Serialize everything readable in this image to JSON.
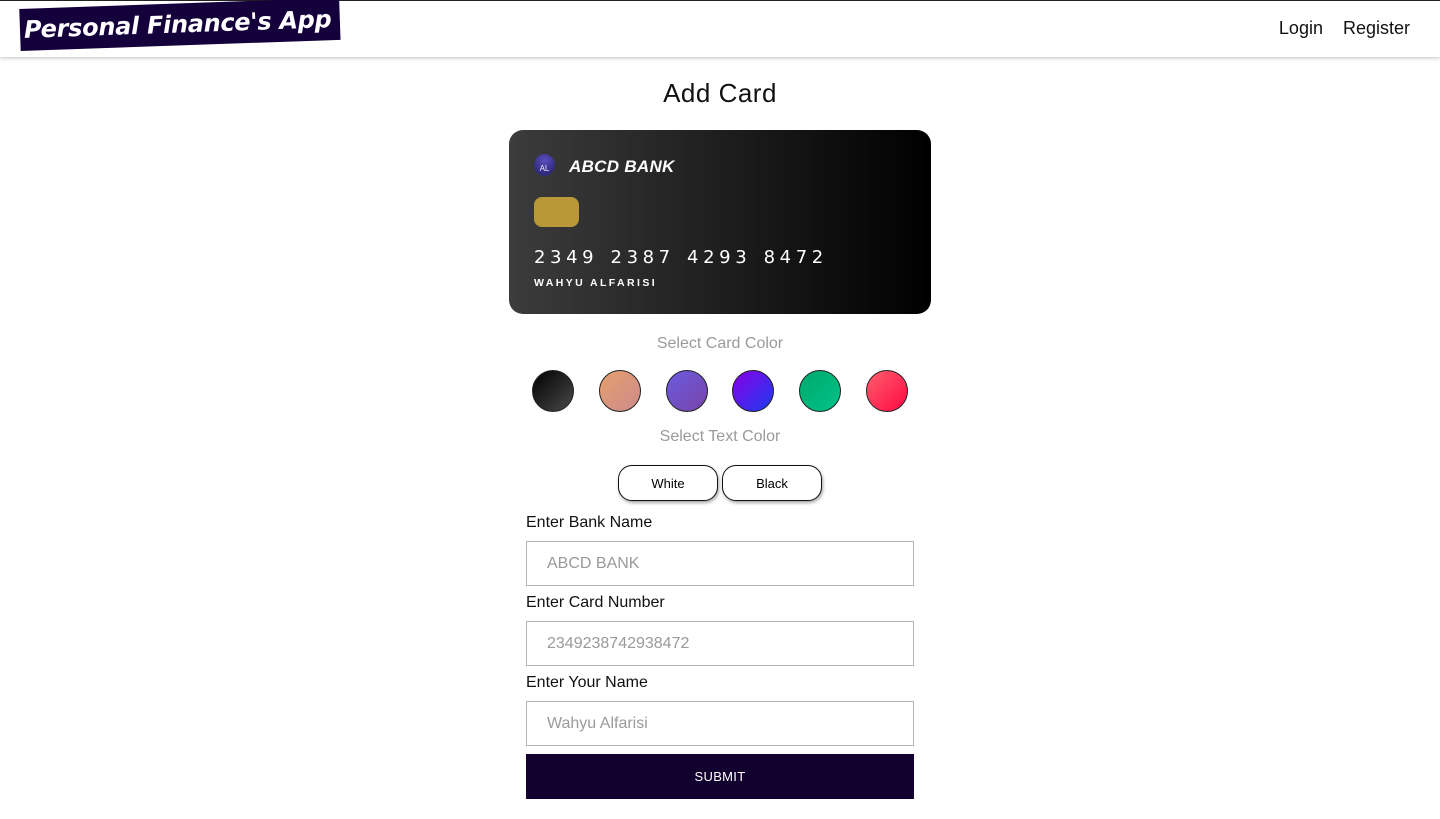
{
  "navbar": {
    "logo_text": "Personal Finance's App",
    "links": [
      "Login",
      "Register"
    ]
  },
  "page": {
    "title": "Add Card"
  },
  "card_preview": {
    "logo_text": "AL",
    "bank_name": "ABCD BANK",
    "number": "2349 2387 4293 8472",
    "holder": "WAHYU ALFARISI",
    "background": "black-gradient",
    "text_color": "#ffffff",
    "chip_color": "#b89838"
  },
  "card_color": {
    "label": "Select Card Color",
    "options": [
      {
        "name": "black",
        "colors": [
          "#000000",
          "#4a4a4a"
        ]
      },
      {
        "name": "peach",
        "colors": [
          "#e6a06e",
          "#cc8a8a"
        ]
      },
      {
        "name": "purple",
        "colors": [
          "#6a5be0",
          "#7a44a8"
        ]
      },
      {
        "name": "violet-blue",
        "colors": [
          "#8a00e6",
          "#1a3cf0"
        ]
      },
      {
        "name": "green",
        "colors": [
          "#00a86b",
          "#00c389"
        ]
      },
      {
        "name": "red-pink",
        "colors": [
          "#ff5f6d",
          "#ff0844"
        ]
      }
    ]
  },
  "text_color": {
    "label": "Select Text Color",
    "options": [
      "White",
      "Black"
    ]
  },
  "form": {
    "bank_name": {
      "label": "Enter Bank Name",
      "placeholder": "ABCD BANK"
    },
    "card_number": {
      "label": "Enter Card Number",
      "placeholder": "2349238742938472"
    },
    "your_name": {
      "label": "Enter Your Name",
      "placeholder": "Wahyu Alfarisi"
    },
    "submit_label": "SUBMIT"
  }
}
